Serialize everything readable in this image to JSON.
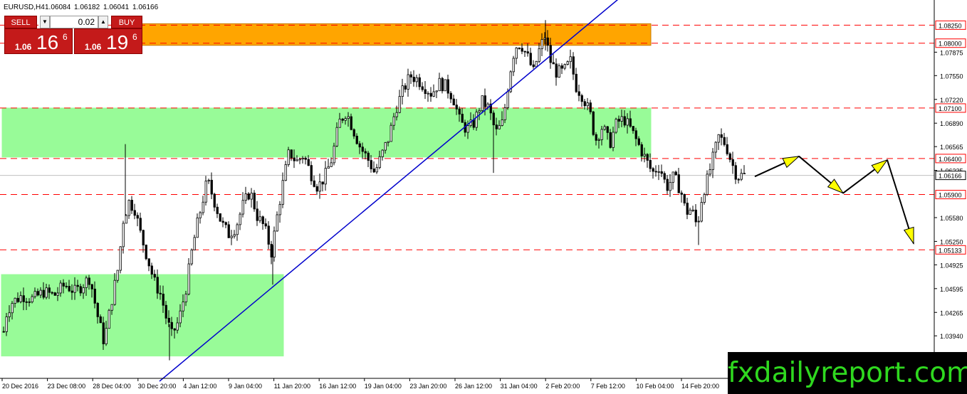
{
  "title_line": {
    "symbol": "EURUSD,H4",
    "open": "1.06084",
    "high": "1.06182",
    "low": "1.06041",
    "close": "1.06166"
  },
  "trade_panel": {
    "sell_label": "SELL",
    "buy_label": "BUY",
    "lot": "0.02",
    "sell_prefix": "1.06",
    "sell_big": "16",
    "sell_sup": "6",
    "buy_prefix": "1.06",
    "buy_big": "19",
    "buy_sup": "6"
  },
  "watermark": "fxdailyreport.com",
  "chart_data": {
    "type": "candlestick",
    "symbol": "EURUSD",
    "timeframe": "H4",
    "x_tick_labels": [
      "20 Dec 2016",
      "23 Dec 08:00",
      "28 Dec 04:00",
      "30 Dec 20:00",
      "4 Jan 12:00",
      "9 Jan 04:00",
      "11 Jan 20:00",
      "16 Jan 12:00",
      "19 Jan 04:00",
      "23 Jan 20:00",
      "26 Jan 12:00",
      "31 Jan 04:00",
      "2 Feb 20:00",
      "7 Feb 12:00",
      "10 Feb 04:00",
      "14 Feb 20:00"
    ],
    "y_tick_labels": [
      "1.07875",
      "1.07550",
      "1.07220",
      "1.06890",
      "1.06565",
      "1.06235",
      "1.05580",
      "1.05250",
      "1.04925",
      "1.04595",
      "1.04265",
      "1.03940"
    ],
    "ylim": [
      1.0335,
      1.0852
    ],
    "grid": false,
    "current_price": "1.06166",
    "price_path": [
      [
        0,
        1.0375
      ],
      [
        8,
        1.0425
      ],
      [
        15,
        1.044
      ],
      [
        30,
        1.045
      ],
      [
        45,
        1.0445
      ],
      [
        60,
        1.0455
      ],
      [
        75,
        1.045
      ],
      [
        90,
        1.0465
      ],
      [
        105,
        1.0455
      ],
      [
        115,
        1.0465
      ],
      [
        125,
        1.0475
      ],
      [
        135,
        1.0425
      ],
      [
        145,
        1.0385
      ],
      [
        155,
        1.044
      ],
      [
        165,
        1.049
      ],
      [
        172,
        1.0555
      ],
      [
        180,
        1.058
      ],
      [
        188,
        1.057
      ],
      [
        195,
        1.054
      ],
      [
        205,
        1.0505
      ],
      [
        215,
        1.047
      ],
      [
        225,
        1.045
      ],
      [
        232,
        1.042
      ],
      [
        240,
        1.0395
      ],
      [
        250,
        1.0415
      ],
      [
        260,
        1.046
      ],
      [
        268,
        1.051
      ],
      [
        275,
        1.0545
      ],
      [
        283,
        1.058
      ],
      [
        290,
        1.061
      ],
      [
        300,
        1.058
      ],
      [
        310,
        1.055
      ],
      [
        320,
        1.0535
      ],
      [
        330,
        1.0545
      ],
      [
        340,
        1.0575
      ],
      [
        350,
        1.0595
      ],
      [
        360,
        1.056
      ],
      [
        370,
        1.0545
      ],
      [
        380,
        1.051
      ],
      [
        388,
        1.056
      ],
      [
        395,
        1.06
      ],
      [
        405,
        1.065
      ],
      [
        415,
        1.0635
      ],
      [
        425,
        1.0645
      ],
      [
        435,
        1.062
      ],
      [
        445,
        1.06
      ],
      [
        455,
        1.0615
      ],
      [
        465,
        1.064
      ],
      [
        475,
        1.069
      ],
      [
        485,
        1.0705
      ],
      [
        495,
        1.068
      ],
      [
        505,
        1.0655
      ],
      [
        515,
        1.064
      ],
      [
        525,
        1.062
      ],
      [
        535,
        1.0645
      ],
      [
        545,
        1.067
      ],
      [
        555,
        1.071
      ],
      [
        565,
        1.0735
      ],
      [
        575,
        1.0755
      ],
      [
        585,
        1.075
      ],
      [
        595,
        1.074
      ],
      [
        605,
        1.073
      ],
      [
        615,
        1.0745
      ],
      [
        625,
        1.074
      ],
      [
        635,
        1.0725
      ],
      [
        645,
        1.069
      ],
      [
        655,
        1.068
      ],
      [
        665,
        1.069
      ],
      [
        675,
        1.072
      ],
      [
        685,
        1.071
      ],
      [
        695,
        1.0675
      ],
      [
        705,
        1.069
      ],
      [
        715,
        1.076
      ],
      [
        722,
        1.0795
      ],
      [
        730,
        1.08
      ],
      [
        740,
        1.078
      ],
      [
        748,
        1.076
      ],
      [
        756,
        1.079
      ],
      [
        764,
        1.081
      ],
      [
        772,
        1.0775
      ],
      [
        780,
        1.076
      ],
      [
        790,
        1.076
      ],
      [
        800,
        1.0775
      ],
      [
        808,
        1.074
      ],
      [
        818,
        1.0725
      ],
      [
        828,
        1.07
      ],
      [
        835,
        1.0665
      ],
      [
        845,
        1.0685
      ],
      [
        855,
        1.066
      ],
      [
        865,
        1.069
      ],
      [
        875,
        1.0695
      ],
      [
        885,
        1.068
      ],
      [
        895,
        1.066
      ],
      [
        905,
        1.064
      ],
      [
        915,
        1.062
      ],
      [
        925,
        1.063
      ],
      [
        935,
        1.06
      ],
      [
        945,
        1.0615
      ],
      [
        955,
        1.0595
      ],
      [
        962,
        1.0565
      ],
      [
        970,
        1.057
      ],
      [
        978,
        1.0545
      ],
      [
        985,
        1.059
      ],
      [
        992,
        1.061
      ],
      [
        1000,
        1.064
      ],
      [
        1008,
        1.067
      ],
      [
        1018,
        1.066
      ],
      [
        1026,
        1.0635
      ],
      [
        1034,
        1.0615
      ],
      [
        1041,
        1.0617
      ]
    ],
    "horizontal_levels": [
      {
        "price": 1.0825,
        "label": "1.08250"
      },
      {
        "price": 1.08,
        "label": "1.08000"
      },
      {
        "price": 1.071,
        "label": "1.07100"
      },
      {
        "price": 1.064,
        "label": "1.06400"
      },
      {
        "price": 1.059,
        "label": "1.05900"
      },
      {
        "price": 1.05133,
        "label": "1.05133"
      }
    ],
    "zones": [
      {
        "color": "#ffa500",
        "border": "#c87a00",
        "price_top": 1.0827,
        "price_bottom": 1.0797,
        "x_start_label": "28 Dec 04:00",
        "x_end_label": "7 Feb 12:00"
      },
      {
        "color": "#98fb98",
        "border": "#98fb98",
        "price_top": 1.071,
        "price_bottom": 1.0642,
        "x_start_label": "20 Dec 2016",
        "x_end_label": "7 Feb 12:00"
      },
      {
        "color": "#98fb98",
        "border": "#98fb98",
        "price_top": 1.0479,
        "price_bottom": 1.0366,
        "x_start_label": "20 Dec 2016",
        "x_end_label": "11 Jan 20:00"
      }
    ],
    "trendline": {
      "color": "#0000cc",
      "from_price": 1.033,
      "to_price": 1.087
    },
    "projection_path": [
      1.0615,
      1.0643,
      1.0592,
      1.0638,
      1.0522
    ],
    "projection_color": "#ffff00",
    "line_color": "#ff0000",
    "candle_color": "#000000"
  }
}
